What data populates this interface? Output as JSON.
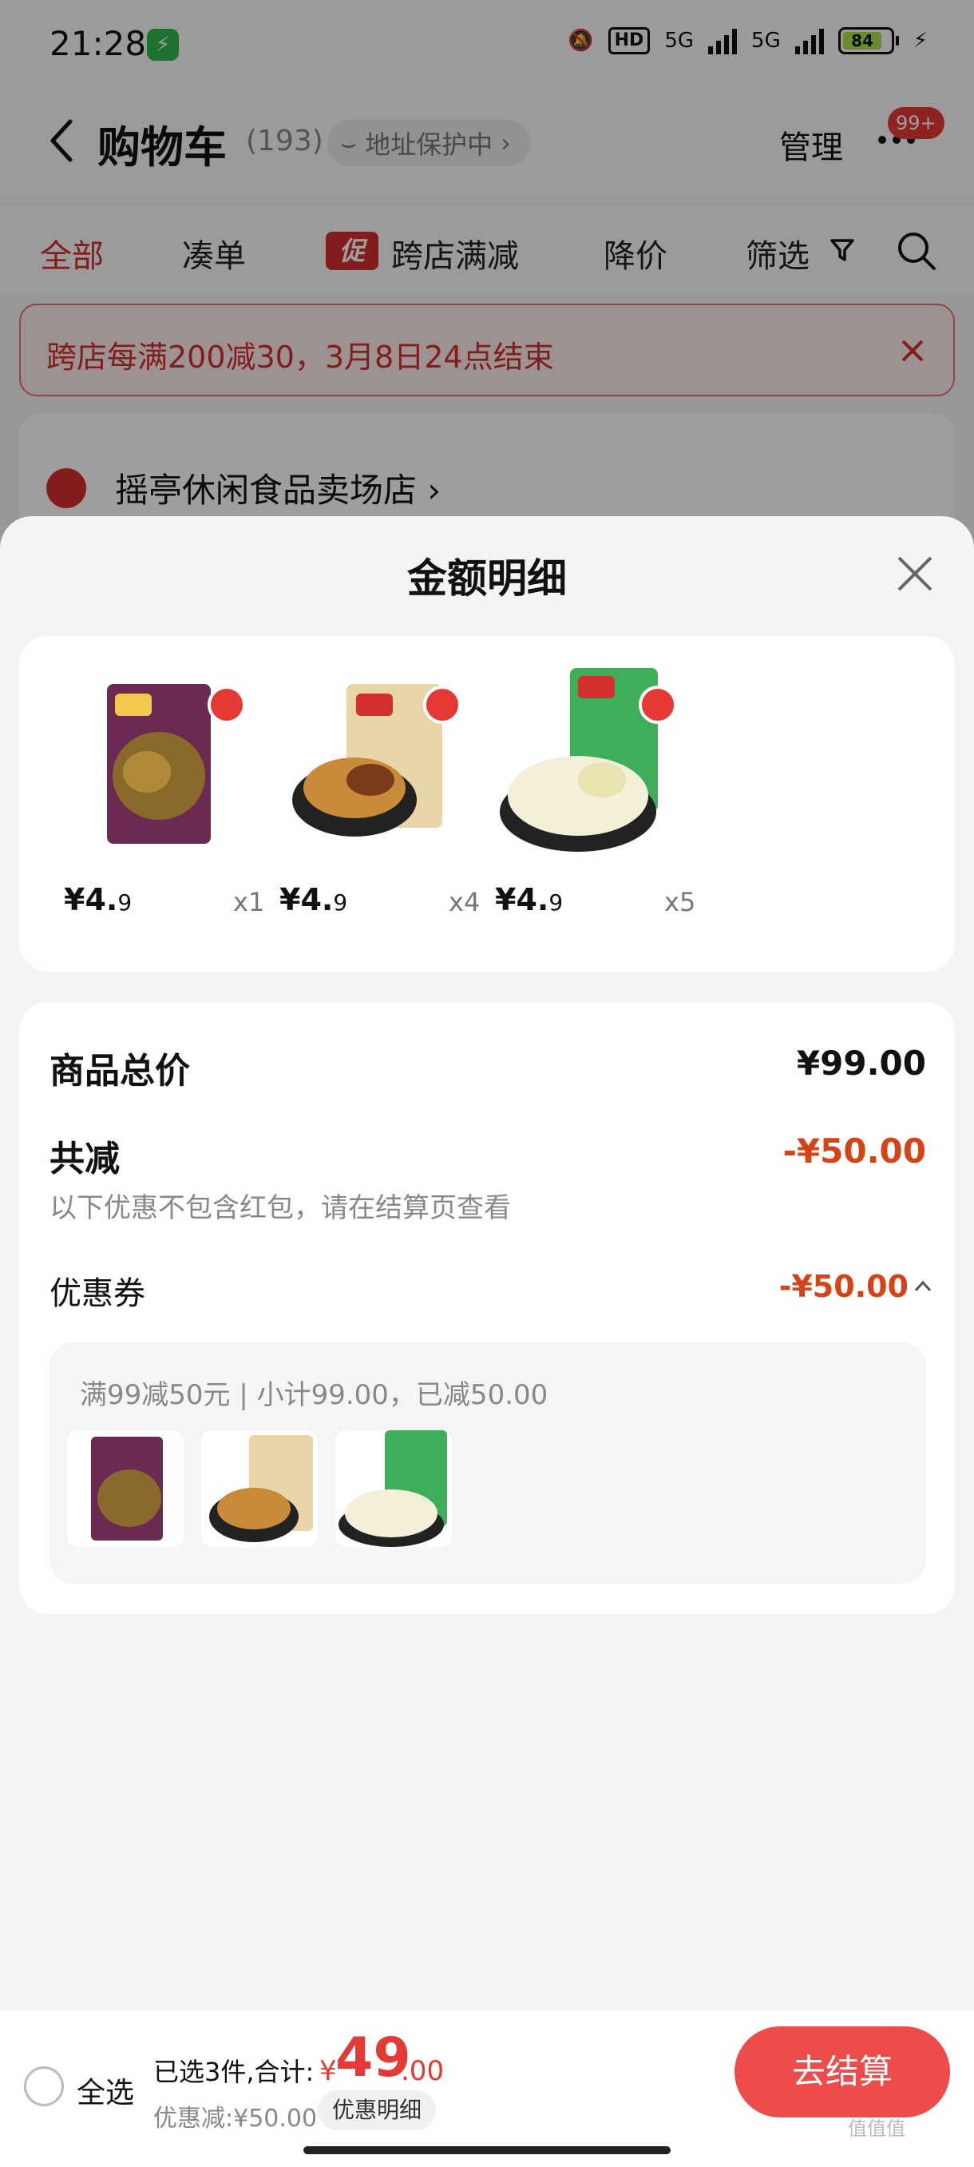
{
  "status_bar": {
    "time": "21:28",
    "network_hd": "HD",
    "network_1": "5G",
    "network_2": "5G",
    "battery": "84"
  },
  "header": {
    "title": "购物车",
    "count": "(193)",
    "address_protection": "地址保护中",
    "manage": "管理",
    "message_badge": "99+"
  },
  "tabs": {
    "all": "全部",
    "combine": "凑单",
    "promo_tag": "促",
    "cross_store": "跨店满减",
    "price_drop": "降价",
    "filter": "筛选"
  },
  "promo_banner": {
    "text": "跨店每满200减30，3月8日24点结束"
  },
  "store": {
    "name": "摇亭休闲食品卖场店"
  },
  "sheet": {
    "title": "金额明细",
    "products": [
      {
        "price_int": "¥4.",
        "price_dec": "9",
        "qty": "x1",
        "color": "#6b2a52"
      },
      {
        "price_int": "¥4.",
        "price_dec": "9",
        "qty": "x4",
        "color": "#c98a3a"
      },
      {
        "price_int": "¥4.",
        "price_dec": "9",
        "qty": "x5",
        "color": "#3fae5a"
      }
    ],
    "total_label": "商品总价",
    "total_value": "¥99.00",
    "discount_label": "共减",
    "discount_value": "-¥50.00",
    "note": "以下优惠不包含红包，请在结算页查看",
    "coupon_label": "优惠券",
    "coupon_value": "-¥50.00",
    "coupon_detail": "满99减50元 | 小计99.00，已减50.00"
  },
  "checkout": {
    "select_all": "全选",
    "selected_text": "已选3件,合计:",
    "currency": "¥",
    "total_int": "49",
    "total_dec": ".00",
    "saved_text": "优惠减:¥50.00",
    "detail_button": "优惠明细",
    "checkout_button": "去结算"
  },
  "watermark": "值值值",
  "colors": {
    "accent_red": "#d32f2f",
    "checkout_red": "#ee4b4b",
    "discount_orange": "#d84315"
  }
}
